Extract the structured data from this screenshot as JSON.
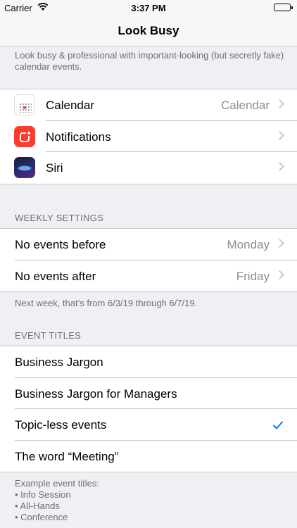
{
  "status_bar": {
    "carrier": "Carrier",
    "time": "3:37 PM"
  },
  "nav": {
    "title": "Look Busy"
  },
  "intro": {
    "text": "Look busy & professional with important-looking (but secretly fake) calendar events."
  },
  "settings_rows": [
    {
      "label": "Calendar",
      "value": "Calendar",
      "icon": "calendar-icon"
    },
    {
      "label": "Notifications",
      "value": "",
      "icon": "notifications-icon"
    },
    {
      "label": "Siri",
      "value": "",
      "icon": "siri-icon"
    }
  ],
  "weekly": {
    "header": "WEEKLY SETTINGS",
    "rows": [
      {
        "label": "No events before",
        "value": "Monday"
      },
      {
        "label": "No events after",
        "value": "Friday"
      }
    ],
    "footer": "Next week, that’s from 6/3/19 through 6/7/19."
  },
  "titles": {
    "header": "EVENT TITLES",
    "rows": [
      {
        "label": "Business Jargon",
        "checked": false
      },
      {
        "label": "Business Jargon for Managers",
        "checked": false
      },
      {
        "label": "Topic-less events",
        "checked": true
      },
      {
        "label": "The word “Meeting”",
        "checked": false
      }
    ],
    "footer_title": "Example event titles:",
    "examples": [
      "• Info Session",
      "• All-Hands",
      "• Conference"
    ]
  },
  "accent_color": "#007aff"
}
